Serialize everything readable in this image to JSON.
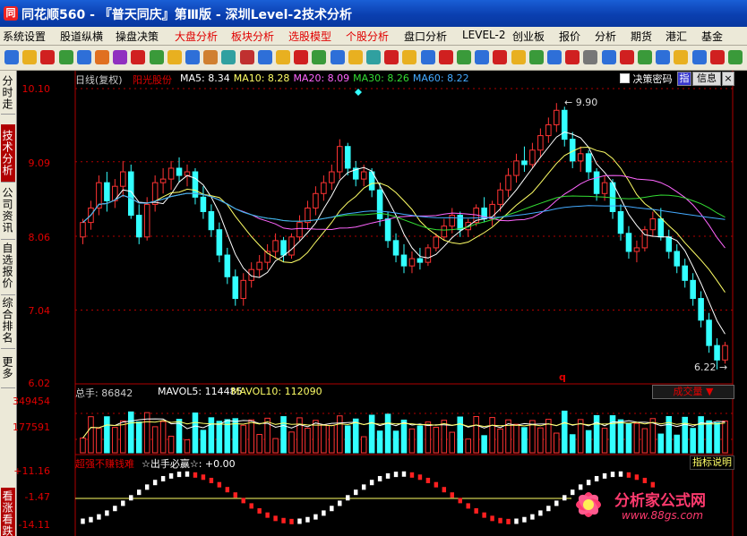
{
  "window": {
    "title": "同花顺560 - 『普天同庆』第Ⅲ版 - 深圳Level-2技术分析"
  },
  "menu": [
    "系统设置",
    "股道纵横",
    "操盘决策",
    "大盘分析",
    "板块分析",
    "选股模型",
    "个股分析",
    "盘口分析",
    "LEVEL-2",
    "创业板",
    "报价",
    "分析",
    "期货",
    "港汇",
    "基金"
  ],
  "menu_red_indices": [
    3,
    4,
    5,
    6
  ],
  "left_tabs": [
    {
      "label": "分时走势",
      "active": false
    },
    {
      "label": "技术分析",
      "active": true
    },
    {
      "label": "公司资讯",
      "active": false
    },
    {
      "label": "自选报价",
      "active": false
    },
    {
      "label": "综合排名",
      "active": false
    },
    {
      "label": "更多",
      "active": false
    },
    {
      "label": "看涨看跌",
      "active": true
    }
  ],
  "price_panel": {
    "period": "日线(复权)",
    "stock": "阳光股份",
    "ma": [
      {
        "label": "MA5: 8.34",
        "color": "#ffffff"
      },
      {
        "label": "MA10: 8.28",
        "color": "#ffff66"
      },
      {
        "label": "MA20: 8.09",
        "color": "#ff66ff"
      },
      {
        "label": "MA30: 8.26",
        "color": "#33dd33"
      },
      {
        "label": "MA60: 8.22",
        "color": "#44aaff"
      }
    ],
    "checkbox_label": "决策密码",
    "btn_zhi": "指",
    "btn_info": "信息",
    "y_ticks": [
      "10.10",
      "9.09",
      "8.06",
      "7.04",
      "6.02"
    ],
    "high_label": "9.90",
    "low_label": "6.22",
    "q_marker": "q"
  },
  "volume_panel": {
    "label": "总手: 86842",
    "mavol5": "MAVOL5: 114485",
    "mavol10": "MAVOL10: 112090",
    "y_ticks": [
      "349454",
      "177591"
    ],
    "type_label": "成交量"
  },
  "indicator_panel": {
    "name": "超强不赚钱难",
    "line": "☆出手必赢☆: +0.00",
    "button": "指标说明",
    "y_ticks": [
      "+11.16",
      "-1.47",
      "-14.11"
    ]
  },
  "watermark": {
    "title": "分析家公式网",
    "url": "www.88gs.com"
  },
  "colors": {
    "up": "#ff3333",
    "down": "#33ffff",
    "axis": "#b00000",
    "ylabel": "#e00000"
  },
  "chart_data": {
    "type": "candlestick",
    "y_range": [
      6.02,
      10.1
    ],
    "candles": [
      {
        "o": 8.05,
        "h": 8.3,
        "l": 7.95,
        "c": 8.25
      },
      {
        "o": 8.25,
        "h": 8.55,
        "l": 8.15,
        "c": 8.45
      },
      {
        "o": 8.45,
        "h": 8.9,
        "l": 8.35,
        "c": 8.8
      },
      {
        "o": 8.8,
        "h": 8.95,
        "l": 8.4,
        "c": 8.55
      },
      {
        "o": 8.55,
        "h": 8.85,
        "l": 8.45,
        "c": 8.75
      },
      {
        "o": 8.75,
        "h": 9.1,
        "l": 8.6,
        "c": 8.95
      },
      {
        "o": 8.95,
        "h": 9.05,
        "l": 8.3,
        "c": 8.35
      },
      {
        "o": 8.35,
        "h": 8.5,
        "l": 7.95,
        "c": 8.05
      },
      {
        "o": 8.05,
        "h": 8.6,
        "l": 8.0,
        "c": 8.5
      },
      {
        "o": 8.5,
        "h": 8.9,
        "l": 8.4,
        "c": 8.8
      },
      {
        "o": 8.8,
        "h": 9.0,
        "l": 8.65,
        "c": 8.85
      },
      {
        "o": 8.85,
        "h": 9.1,
        "l": 8.7,
        "c": 9.0
      },
      {
        "o": 9.0,
        "h": 9.15,
        "l": 8.8,
        "c": 8.9
      },
      {
        "o": 8.9,
        "h": 9.05,
        "l": 8.75,
        "c": 8.95
      },
      {
        "o": 8.95,
        "h": 9.0,
        "l": 8.5,
        "c": 8.6
      },
      {
        "o": 8.6,
        "h": 8.75,
        "l": 8.3,
        "c": 8.4
      },
      {
        "o": 8.4,
        "h": 8.5,
        "l": 8.05,
        "c": 8.15
      },
      {
        "o": 8.15,
        "h": 8.25,
        "l": 7.7,
        "c": 7.8
      },
      {
        "o": 7.8,
        "h": 7.9,
        "l": 7.4,
        "c": 7.5
      },
      {
        "o": 7.5,
        "h": 7.6,
        "l": 7.1,
        "c": 7.2
      },
      {
        "o": 7.2,
        "h": 7.55,
        "l": 7.1,
        "c": 7.45
      },
      {
        "o": 7.45,
        "h": 7.7,
        "l": 7.35,
        "c": 7.6
      },
      {
        "o": 7.6,
        "h": 7.8,
        "l": 7.5,
        "c": 7.7
      },
      {
        "o": 7.7,
        "h": 7.95,
        "l": 7.6,
        "c": 7.85
      },
      {
        "o": 7.85,
        "h": 8.1,
        "l": 7.75,
        "c": 8.0
      },
      {
        "o": 8.0,
        "h": 8.05,
        "l": 7.7,
        "c": 7.8
      },
      {
        "o": 7.8,
        "h": 8.1,
        "l": 7.75,
        "c": 8.05
      },
      {
        "o": 8.05,
        "h": 8.35,
        "l": 8.0,
        "c": 8.25
      },
      {
        "o": 8.25,
        "h": 8.55,
        "l": 8.15,
        "c": 8.45
      },
      {
        "o": 8.45,
        "h": 8.75,
        "l": 8.35,
        "c": 8.65
      },
      {
        "o": 8.65,
        "h": 8.9,
        "l": 8.55,
        "c": 8.8
      },
      {
        "o": 8.8,
        "h": 9.05,
        "l": 8.7,
        "c": 8.95
      },
      {
        "o": 8.95,
        "h": 9.4,
        "l": 8.85,
        "c": 9.3
      },
      {
        "o": 9.3,
        "h": 9.35,
        "l": 8.9,
        "c": 9.0
      },
      {
        "o": 9.0,
        "h": 9.1,
        "l": 8.75,
        "c": 8.85
      },
      {
        "o": 8.85,
        "h": 9.05,
        "l": 8.75,
        "c": 8.95
      },
      {
        "o": 8.95,
        "h": 9.0,
        "l": 8.6,
        "c": 8.7
      },
      {
        "o": 8.7,
        "h": 8.8,
        "l": 8.2,
        "c": 8.3
      },
      {
        "o": 8.3,
        "h": 8.4,
        "l": 7.9,
        "c": 8.0
      },
      {
        "o": 8.0,
        "h": 8.1,
        "l": 7.7,
        "c": 7.8
      },
      {
        "o": 7.8,
        "h": 7.95,
        "l": 7.55,
        "c": 7.65
      },
      {
        "o": 7.65,
        "h": 7.85,
        "l": 7.55,
        "c": 7.75
      },
      {
        "o": 7.75,
        "h": 7.9,
        "l": 7.6,
        "c": 7.7
      },
      {
        "o": 7.7,
        "h": 7.95,
        "l": 7.65,
        "c": 7.9
      },
      {
        "o": 7.9,
        "h": 8.1,
        "l": 7.85,
        "c": 8.05
      },
      {
        "o": 8.05,
        "h": 8.3,
        "l": 8.0,
        "c": 8.2
      },
      {
        "o": 8.2,
        "h": 8.45,
        "l": 8.1,
        "c": 8.35
      },
      {
        "o": 8.35,
        "h": 8.4,
        "l": 8.05,
        "c": 8.15
      },
      {
        "o": 8.15,
        "h": 8.3,
        "l": 8.05,
        "c": 8.25
      },
      {
        "o": 8.25,
        "h": 8.5,
        "l": 8.2,
        "c": 8.45
      },
      {
        "o": 8.45,
        "h": 8.6,
        "l": 8.25,
        "c": 8.3
      },
      {
        "o": 8.3,
        "h": 8.55,
        "l": 8.2,
        "c": 8.5
      },
      {
        "o": 8.5,
        "h": 8.8,
        "l": 8.4,
        "c": 8.7
      },
      {
        "o": 8.7,
        "h": 9.0,
        "l": 8.6,
        "c": 8.9
      },
      {
        "o": 8.9,
        "h": 9.2,
        "l": 8.8,
        "c": 9.1
      },
      {
        "o": 9.1,
        "h": 9.3,
        "l": 8.95,
        "c": 9.05
      },
      {
        "o": 9.05,
        "h": 9.35,
        "l": 9.0,
        "c": 9.25
      },
      {
        "o": 9.25,
        "h": 9.55,
        "l": 9.15,
        "c": 9.45
      },
      {
        "o": 9.45,
        "h": 9.7,
        "l": 9.35,
        "c": 9.6
      },
      {
        "o": 9.6,
        "h": 9.9,
        "l": 9.5,
        "c": 9.8
      },
      {
        "o": 9.8,
        "h": 9.85,
        "l": 9.3,
        "c": 9.4
      },
      {
        "o": 9.4,
        "h": 9.5,
        "l": 9.0,
        "c": 9.1
      },
      {
        "o": 9.1,
        "h": 9.3,
        "l": 8.95,
        "c": 9.2
      },
      {
        "o": 9.2,
        "h": 9.25,
        "l": 8.85,
        "c": 8.95
      },
      {
        "o": 8.95,
        "h": 9.0,
        "l": 8.55,
        "c": 8.65
      },
      {
        "o": 8.65,
        "h": 8.9,
        "l": 8.55,
        "c": 8.8
      },
      {
        "o": 8.8,
        "h": 8.85,
        "l": 8.3,
        "c": 8.4
      },
      {
        "o": 8.4,
        "h": 8.5,
        "l": 8.0,
        "c": 8.1
      },
      {
        "o": 8.1,
        "h": 8.2,
        "l": 7.75,
        "c": 7.85
      },
      {
        "o": 7.85,
        "h": 8.0,
        "l": 7.7,
        "c": 7.9
      },
      {
        "o": 7.9,
        "h": 8.2,
        "l": 7.85,
        "c": 8.15
      },
      {
        "o": 8.15,
        "h": 8.4,
        "l": 8.05,
        "c": 8.3
      },
      {
        "o": 8.3,
        "h": 8.45,
        "l": 8.0,
        "c": 8.05
      },
      {
        "o": 8.05,
        "h": 8.15,
        "l": 7.75,
        "c": 7.85
      },
      {
        "o": 7.85,
        "h": 7.95,
        "l": 7.55,
        "c": 7.65
      },
      {
        "o": 7.65,
        "h": 7.75,
        "l": 7.35,
        "c": 7.45
      },
      {
        "o": 7.45,
        "h": 7.55,
        "l": 7.1,
        "c": 7.2
      },
      {
        "o": 7.2,
        "h": 7.3,
        "l": 6.8,
        "c": 6.9
      },
      {
        "o": 6.9,
        "h": 7.0,
        "l": 6.45,
        "c": 6.55
      },
      {
        "o": 6.55,
        "h": 6.65,
        "l": 6.22,
        "c": 6.35
      },
      {
        "o": 6.35,
        "h": 6.6,
        "l": 6.3,
        "c": 6.55
      }
    ],
    "volume_range": [
      0,
      349454
    ],
    "volume_mavol_level": 114485,
    "indicator_range": [
      -14.11,
      11.16
    ],
    "indicator_zero_level": -1.47
  }
}
